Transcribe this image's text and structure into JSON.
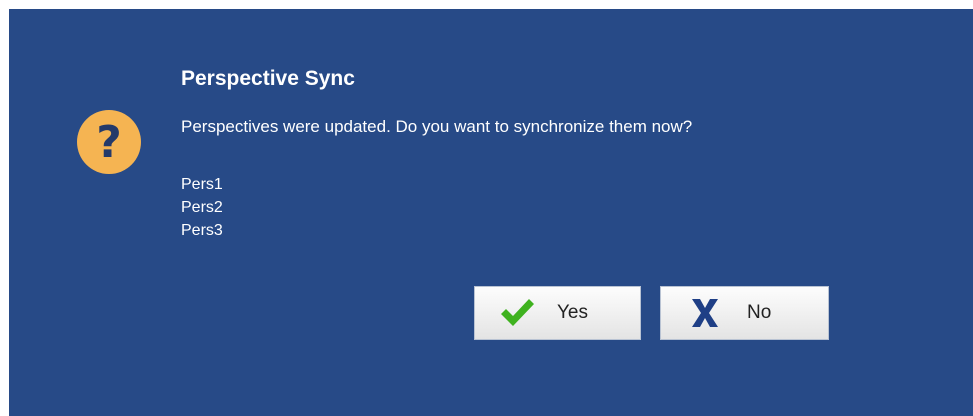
{
  "dialog": {
    "title": "Perspective Sync",
    "message": "Perspectives were updated. Do you want to synchronize them now?",
    "icon": "question-icon",
    "items": [
      "Pers1",
      "Pers2",
      "Pers3"
    ],
    "buttons": {
      "yes": {
        "label": "Yes",
        "icon": "checkmark-icon"
      },
      "no": {
        "label": "No",
        "icon": "x-icon"
      }
    },
    "colors": {
      "background": "#274a87",
      "icon_fill": "#f5b452",
      "check": "#3fb21f",
      "x": "#1f3f86"
    }
  }
}
